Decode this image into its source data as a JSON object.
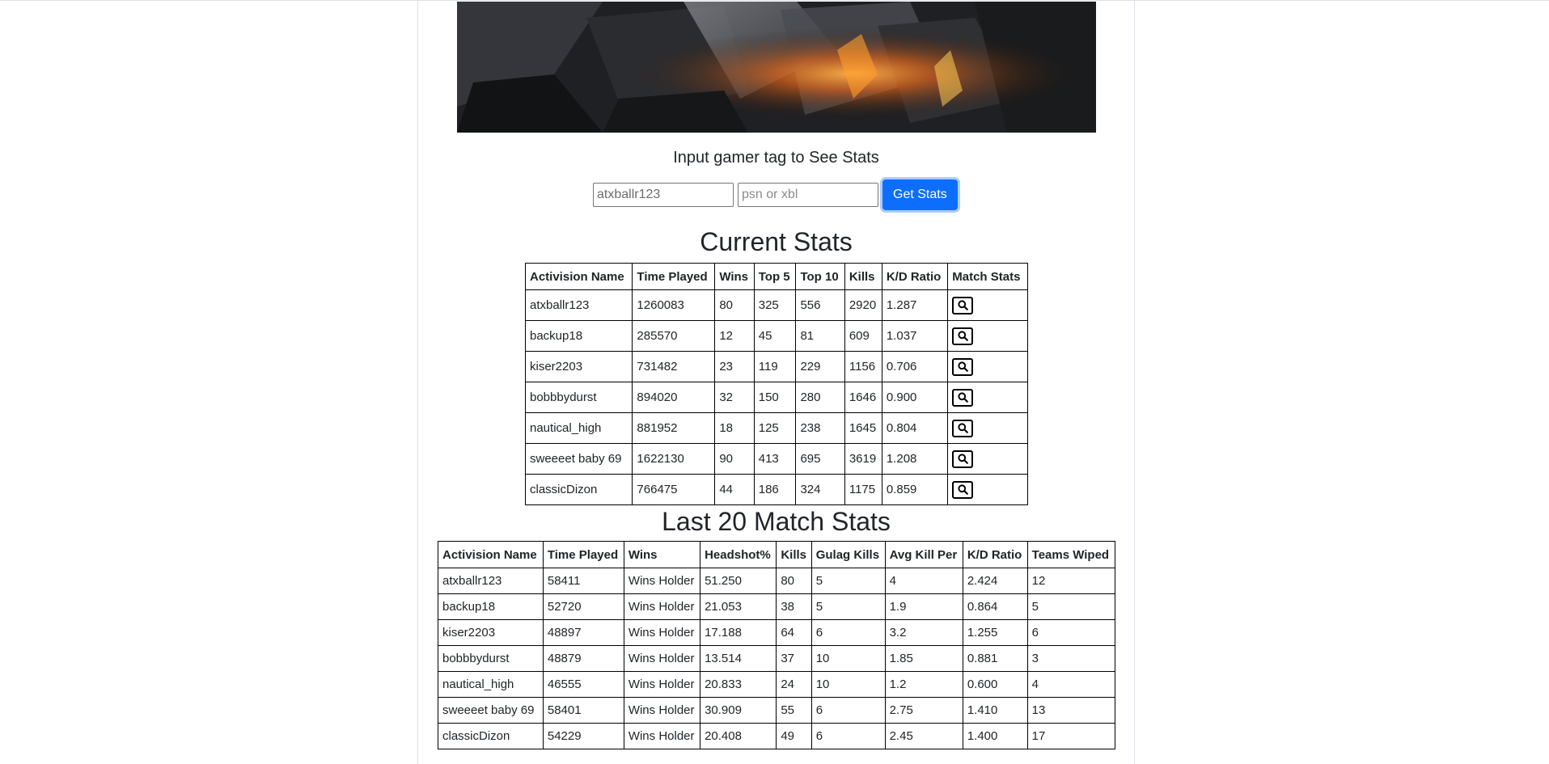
{
  "search": {
    "title": "Input gamer tag to See Stats",
    "gamertag_value": "atxballr123",
    "platform_placeholder": "psn or xbl",
    "button_label": "Get Stats"
  },
  "current": {
    "title": "Current Stats",
    "headers": [
      "Activision Name",
      "Time Played",
      "Wins",
      "Top 5",
      "Top 10",
      "Kills",
      "K/D Ratio",
      "Match Stats"
    ],
    "rows": [
      [
        "atxballr123",
        "1260083",
        "80",
        "325",
        "556",
        "2920",
        "1.287"
      ],
      [
        "backup18",
        "285570",
        "12",
        "45",
        "81",
        "609",
        "1.037"
      ],
      [
        "kiser2203",
        "731482",
        "23",
        "119",
        "229",
        "1156",
        "0.706"
      ],
      [
        "bobbbydurst",
        "894020",
        "32",
        "150",
        "280",
        "1646",
        "0.900"
      ],
      [
        "nautical_high",
        "881952",
        "18",
        "125",
        "238",
        "1645",
        "0.804"
      ],
      [
        "sweeeet baby 69",
        "1622130",
        "90",
        "413",
        "695",
        "3619",
        "1.208"
      ],
      [
        "classicDizon",
        "766475",
        "44",
        "186",
        "324",
        "1175",
        "0.859"
      ]
    ],
    "match_button_icon": "search-icon"
  },
  "last": {
    "title": "Last 20 Match Stats",
    "headers": [
      "Activision Name",
      "Time Played",
      "Wins",
      "Headshot%",
      "Kills",
      "Gulag Kills",
      "Avg Kill Per",
      "K/D Ratio",
      "Teams Wiped"
    ],
    "rows": [
      [
        "atxballr123",
        "58411",
        "Wins Holder",
        "51.250",
        "80",
        "5",
        "4",
        "2.424",
        "12"
      ],
      [
        "backup18",
        "52720",
        "Wins Holder",
        "21.053",
        "38",
        "5",
        "1.9",
        "0.864",
        "5"
      ],
      [
        "kiser2203",
        "48897",
        "Wins Holder",
        "17.188",
        "64",
        "6",
        "3.2",
        "1.255",
        "6"
      ],
      [
        "bobbbydurst",
        "48879",
        "Wins Holder",
        "13.514",
        "37",
        "10",
        "1.85",
        "0.881",
        "3"
      ],
      [
        "nautical_high",
        "46555",
        "Wins Holder",
        "20.833",
        "24",
        "10",
        "1.2",
        "0.600",
        "4"
      ],
      [
        "sweeeet baby 69",
        "58401",
        "Wins Holder",
        "30.909",
        "55",
        "6",
        "2.75",
        "1.410",
        "13"
      ],
      [
        "classicDizon",
        "54229",
        "Wins Holder",
        "20.408",
        "49",
        "6",
        "2.45",
        "1.400",
        "17"
      ]
    ]
  },
  "colors": {
    "accent": "#0d6efd",
    "text": "#212529",
    "border": "#000000"
  }
}
